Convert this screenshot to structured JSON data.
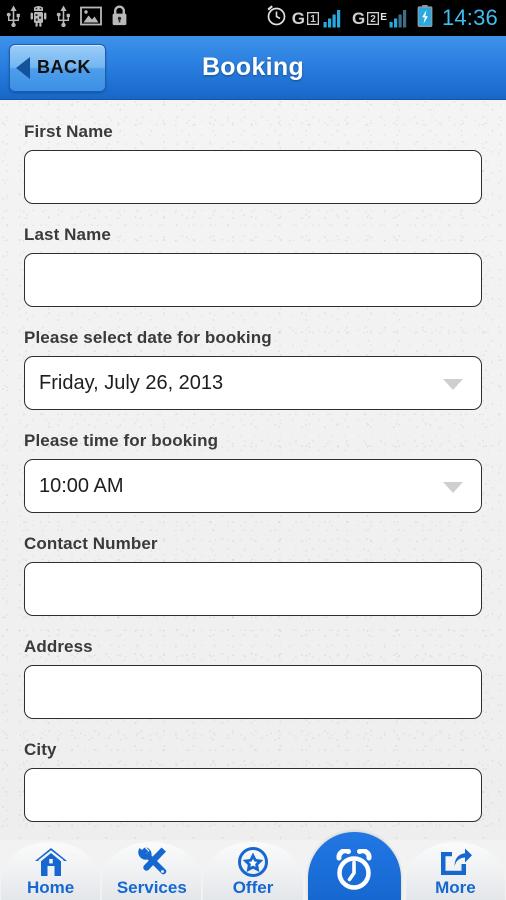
{
  "status_bar": {
    "time": "14:36",
    "left_icons": [
      "usb-icon",
      "android-debug-icon",
      "usb-icon",
      "gallery-image-icon",
      "lock-icon"
    ],
    "right_icons": [
      "alarm-clock-icon",
      "signal-sim1-icon",
      "signal-sim2-edge-icon",
      "battery-charging-icon"
    ],
    "sim1_label": "G",
    "sim1_index": "1",
    "sim2_label": "G",
    "sim2_index": "2",
    "sim2_network": "E"
  },
  "header": {
    "title": "Booking",
    "back_label": "BACK",
    "accent_top": "#3e92ea",
    "accent_bottom": "#1767c9"
  },
  "form": {
    "fields": [
      {
        "label": "First Name",
        "type": "text",
        "value": "",
        "placeholder": ""
      },
      {
        "label": "Last Name",
        "type": "text",
        "value": "",
        "placeholder": ""
      },
      {
        "label": "Please select date for booking",
        "type": "select",
        "value": "Friday, July 26, 2013"
      },
      {
        "label": "Please time for booking",
        "type": "select",
        "value": "10:00 AM"
      },
      {
        "label": "Contact Number",
        "type": "text",
        "value": "",
        "placeholder": ""
      },
      {
        "label": "Address",
        "type": "text",
        "value": "",
        "placeholder": ""
      },
      {
        "label": "City",
        "type": "text",
        "value": "",
        "placeholder": ""
      }
    ]
  },
  "tabbar": {
    "accent": "#1668d0",
    "items": [
      {
        "label": "Home",
        "icon": "home-icon",
        "active": false
      },
      {
        "label": "Services",
        "icon": "tools-icon",
        "active": false
      },
      {
        "label": "Offer",
        "icon": "star-badge-icon",
        "active": false
      },
      {
        "label": "",
        "icon": "alarm-clock-icon",
        "active": true
      },
      {
        "label": "More",
        "icon": "share-icon",
        "active": false
      }
    ]
  }
}
